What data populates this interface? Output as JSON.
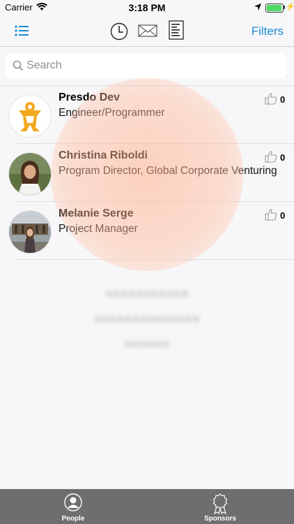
{
  "status_bar": {
    "carrier": "Carrier",
    "time": "3:18 PM"
  },
  "nav": {
    "filters_label": "Filters"
  },
  "search": {
    "placeholder": "Search"
  },
  "people": [
    {
      "name": "Presdo Dev",
      "title": "Engineer/Programmer",
      "likes": "0",
      "avatar": "presdo-logo"
    },
    {
      "name": "Christina Riboldi",
      "title": "Program Director, Global Corporate Venturing",
      "likes": "0",
      "avatar": "photo"
    },
    {
      "name": "Melanie Serge",
      "title": "Project Manager",
      "likes": "0",
      "avatar": "photo"
    }
  ],
  "tabbar": {
    "people_label": "People",
    "sponsors_label": "Sponsors"
  },
  "colors": {
    "accent": "#1a8bd6",
    "tabbar": "#6e6e70",
    "overlay": "#ffb08c"
  }
}
